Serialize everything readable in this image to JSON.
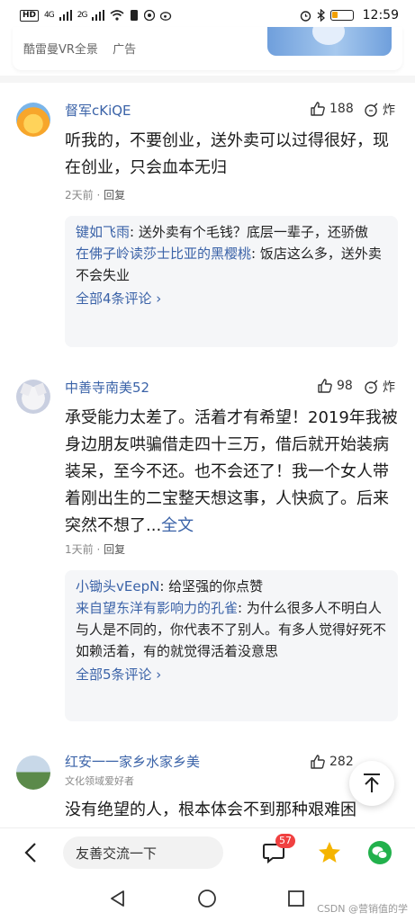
{
  "status_bar": {
    "left_chip": "HD",
    "sig1": "4G",
    "sig2": "2G",
    "time": "12:59"
  },
  "ad": {
    "label": "酷雷曼VR全景",
    "tag": "广告"
  },
  "comments": [
    {
      "user": "督军cKiQE",
      "likes": "188",
      "bomb": "炸",
      "text": "听我的，不要创业，送外卖可以过得很好，现在创业，只会血本无归",
      "time": "2天前",
      "reply": "回复",
      "replies": [
        {
          "name": "键如飞雨",
          "text": "送外卖有个毛钱？底层一辈子，还骄傲"
        },
        {
          "name": "在佛子岭读莎士比亚的黑樱桃",
          "text": "饭店这么多，送外卖不会失业"
        }
      ],
      "all_replies": "全部4条评论 ›"
    },
    {
      "user": "中善寺南美52",
      "likes": "98",
      "bomb": "炸",
      "text": "承受能力太差了。活着才有希望！2019年我被身边朋友哄骗借走四十三万，借后就开始装病装呆，至今不还。也不会还了！我一个女人带着刚出生的二宝整天想这事，人快疯了。后来突然不想了...",
      "more": "全文",
      "time": "1天前",
      "reply": "回复",
      "replies": [
        {
          "name": "小锄头vEepN",
          "text": "给坚强的你点赞"
        },
        {
          "name": "来自望东洋有影响力的孔雀",
          "text": "为什么很多人不明白人与人是不同的，你代表不了别人。有多人觉得好死不如赖活着，有的就觉得活着没意思"
        }
      ],
      "all_replies": "全部5条评论 ›"
    },
    {
      "user": "红安一一家乡水家乡美",
      "subtitle": "文化领域爱好者",
      "likes": "282",
      "bomb": "炸",
      "text": "没有绝望的人，根本体会不到那种艰难困"
    }
  ],
  "bottom_bar": {
    "input_placeholder": "友善交流一下",
    "comment_count": "57"
  },
  "watermark": "CSDN @营销值的学",
  "colors": {
    "link_blue": "#3b63a8",
    "badge_red": "#f04040",
    "star_gold": "#f5b400",
    "wechat_green": "#22b14c"
  }
}
